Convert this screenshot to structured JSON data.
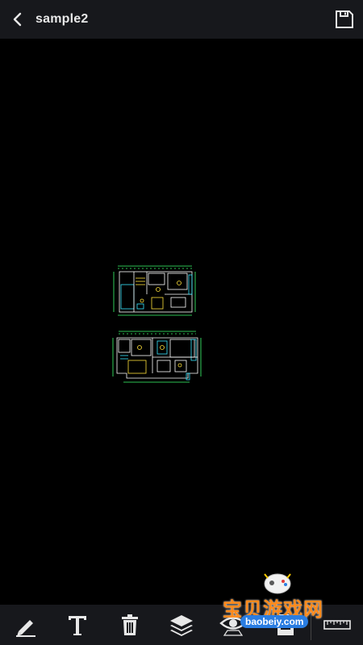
{
  "header": {
    "back_icon": "chevron-left-icon",
    "title": "sample2",
    "save_icon": "floppy-disk-icon"
  },
  "toolbar": {
    "tools": [
      {
        "icon": "pencil-icon",
        "name": "draw"
      },
      {
        "icon": "text-icon",
        "name": "text"
      },
      {
        "icon": "trash-icon",
        "name": "delete"
      },
      {
        "icon": "layers-icon",
        "name": "layers"
      },
      {
        "icon": "eye-icon",
        "name": "view"
      },
      {
        "icon": "document-icon",
        "name": "document"
      },
      {
        "icon": "ruler-icon",
        "name": "measure"
      }
    ]
  },
  "watermark": {
    "title": "宝贝游戏网",
    "url": "baobeiy.com"
  },
  "colors": {
    "bar_bg": "#17181c",
    "canvas_bg": "#000000",
    "drawing_cyan": "#39e6ff",
    "drawing_green": "#3dff6e",
    "drawing_yellow": "#ffe23a",
    "drawing_white": "#ffffff"
  }
}
